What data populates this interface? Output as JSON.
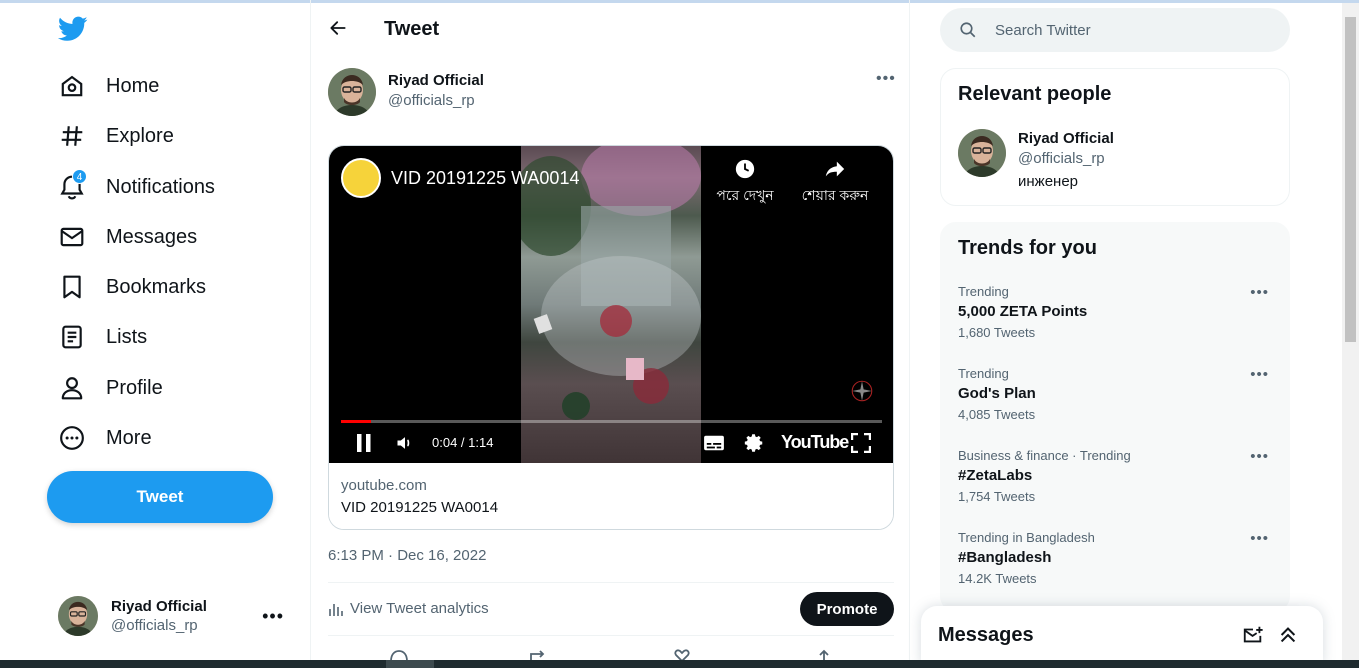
{
  "nav": {
    "items": [
      {
        "label": "Home",
        "icon": "home-icon"
      },
      {
        "label": "Explore",
        "icon": "hashtag-icon"
      },
      {
        "label": "Notifications",
        "icon": "bell-icon",
        "badge": "4"
      },
      {
        "label": "Messages",
        "icon": "envelope-icon"
      },
      {
        "label": "Bookmarks",
        "icon": "bookmark-icon"
      },
      {
        "label": "Lists",
        "icon": "list-icon"
      },
      {
        "label": "Profile",
        "icon": "person-icon"
      },
      {
        "label": "More",
        "icon": "more-circle-icon"
      }
    ],
    "tweet_button": "Tweet",
    "account": {
      "name": "Riyad Official",
      "handle": "@officials_rp"
    }
  },
  "main": {
    "title": "Tweet",
    "author": {
      "name": "Riyad Official",
      "handle": "@officials_rp"
    },
    "video": {
      "title": "VID 20191225 WA0014",
      "watch_later": "পরে দেখুন",
      "share": "শেয়ার করুন",
      "time": "0:04 / 1:14",
      "progress": 0.055,
      "brand": "YouTube"
    },
    "card": {
      "domain": "youtube.com",
      "title": "VID 20191225 WA0014"
    },
    "timestamp": "6:13 PM · Dec 16, 2022",
    "analytics": "View Tweet analytics",
    "promote": "Promote"
  },
  "right": {
    "search_placeholder": "Search Twitter",
    "relevant": {
      "title": "Relevant people",
      "person": {
        "name": "Riyad Official",
        "handle": "@officials_rp",
        "bio": "инженер"
      }
    },
    "trends": {
      "title": "Trends for you",
      "items": [
        {
          "context": "Trending",
          "name": "5,000 ZETA Points",
          "count": "1,680 Tweets"
        },
        {
          "context": "Trending",
          "name": "God's Plan",
          "count": "4,085 Tweets"
        },
        {
          "context": "Business & finance · Trending",
          "name": "#ZetaLabs",
          "count": "1,754 Tweets"
        },
        {
          "context": "Trending in Bangladesh",
          "name": "#Bangladesh",
          "count": "14.2K Tweets"
        }
      ]
    },
    "messages": {
      "title": "Messages"
    }
  },
  "colors": {
    "accent": "#1d9bf0",
    "text": "#0f1419",
    "secondary": "#536471"
  }
}
